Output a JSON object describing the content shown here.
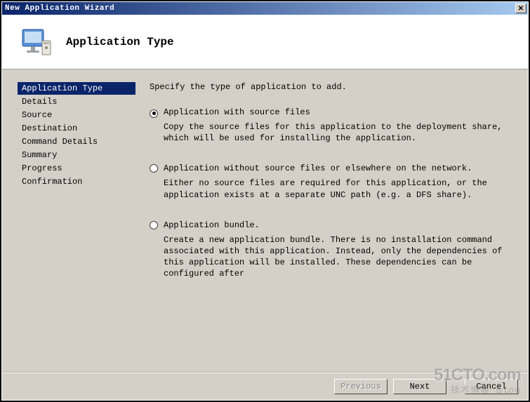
{
  "window": {
    "title": "New Application Wizard"
  },
  "header": {
    "title": "Application Type"
  },
  "sidebar": {
    "items": [
      {
        "label": "Application Type",
        "active": true
      },
      {
        "label": "Details",
        "active": false
      },
      {
        "label": "Source",
        "active": false
      },
      {
        "label": "Destination",
        "active": false
      },
      {
        "label": "Command Details",
        "active": false
      },
      {
        "label": "Summary",
        "active": false
      },
      {
        "label": "Progress",
        "active": false
      },
      {
        "label": "Confirmation",
        "active": false
      }
    ]
  },
  "content": {
    "heading": "Specify the type of application to add.",
    "options": [
      {
        "label": "Application with source files",
        "desc": "Copy the source files for this application to the deployment share, which will be used for installing the application.",
        "selected": true
      },
      {
        "label": "Application without source files or elsewhere on the network.",
        "desc": "Either no source files are required for this application, or the application exists at a separate UNC path (e.g. a DFS share).",
        "selected": false
      },
      {
        "label": "Application bundle.",
        "desc": "Create a new application bundle.  There is no installation command associated with this application.  Instead, only the dependencies of this application will be installed.  These dependencies can be configured after",
        "selected": false
      }
    ]
  },
  "footer": {
    "previous": "Previous",
    "next": "Next",
    "cancel": "Cancel"
  },
  "watermark": {
    "line1": "51CTO.com",
    "line2": "技术博客 Blog"
  }
}
